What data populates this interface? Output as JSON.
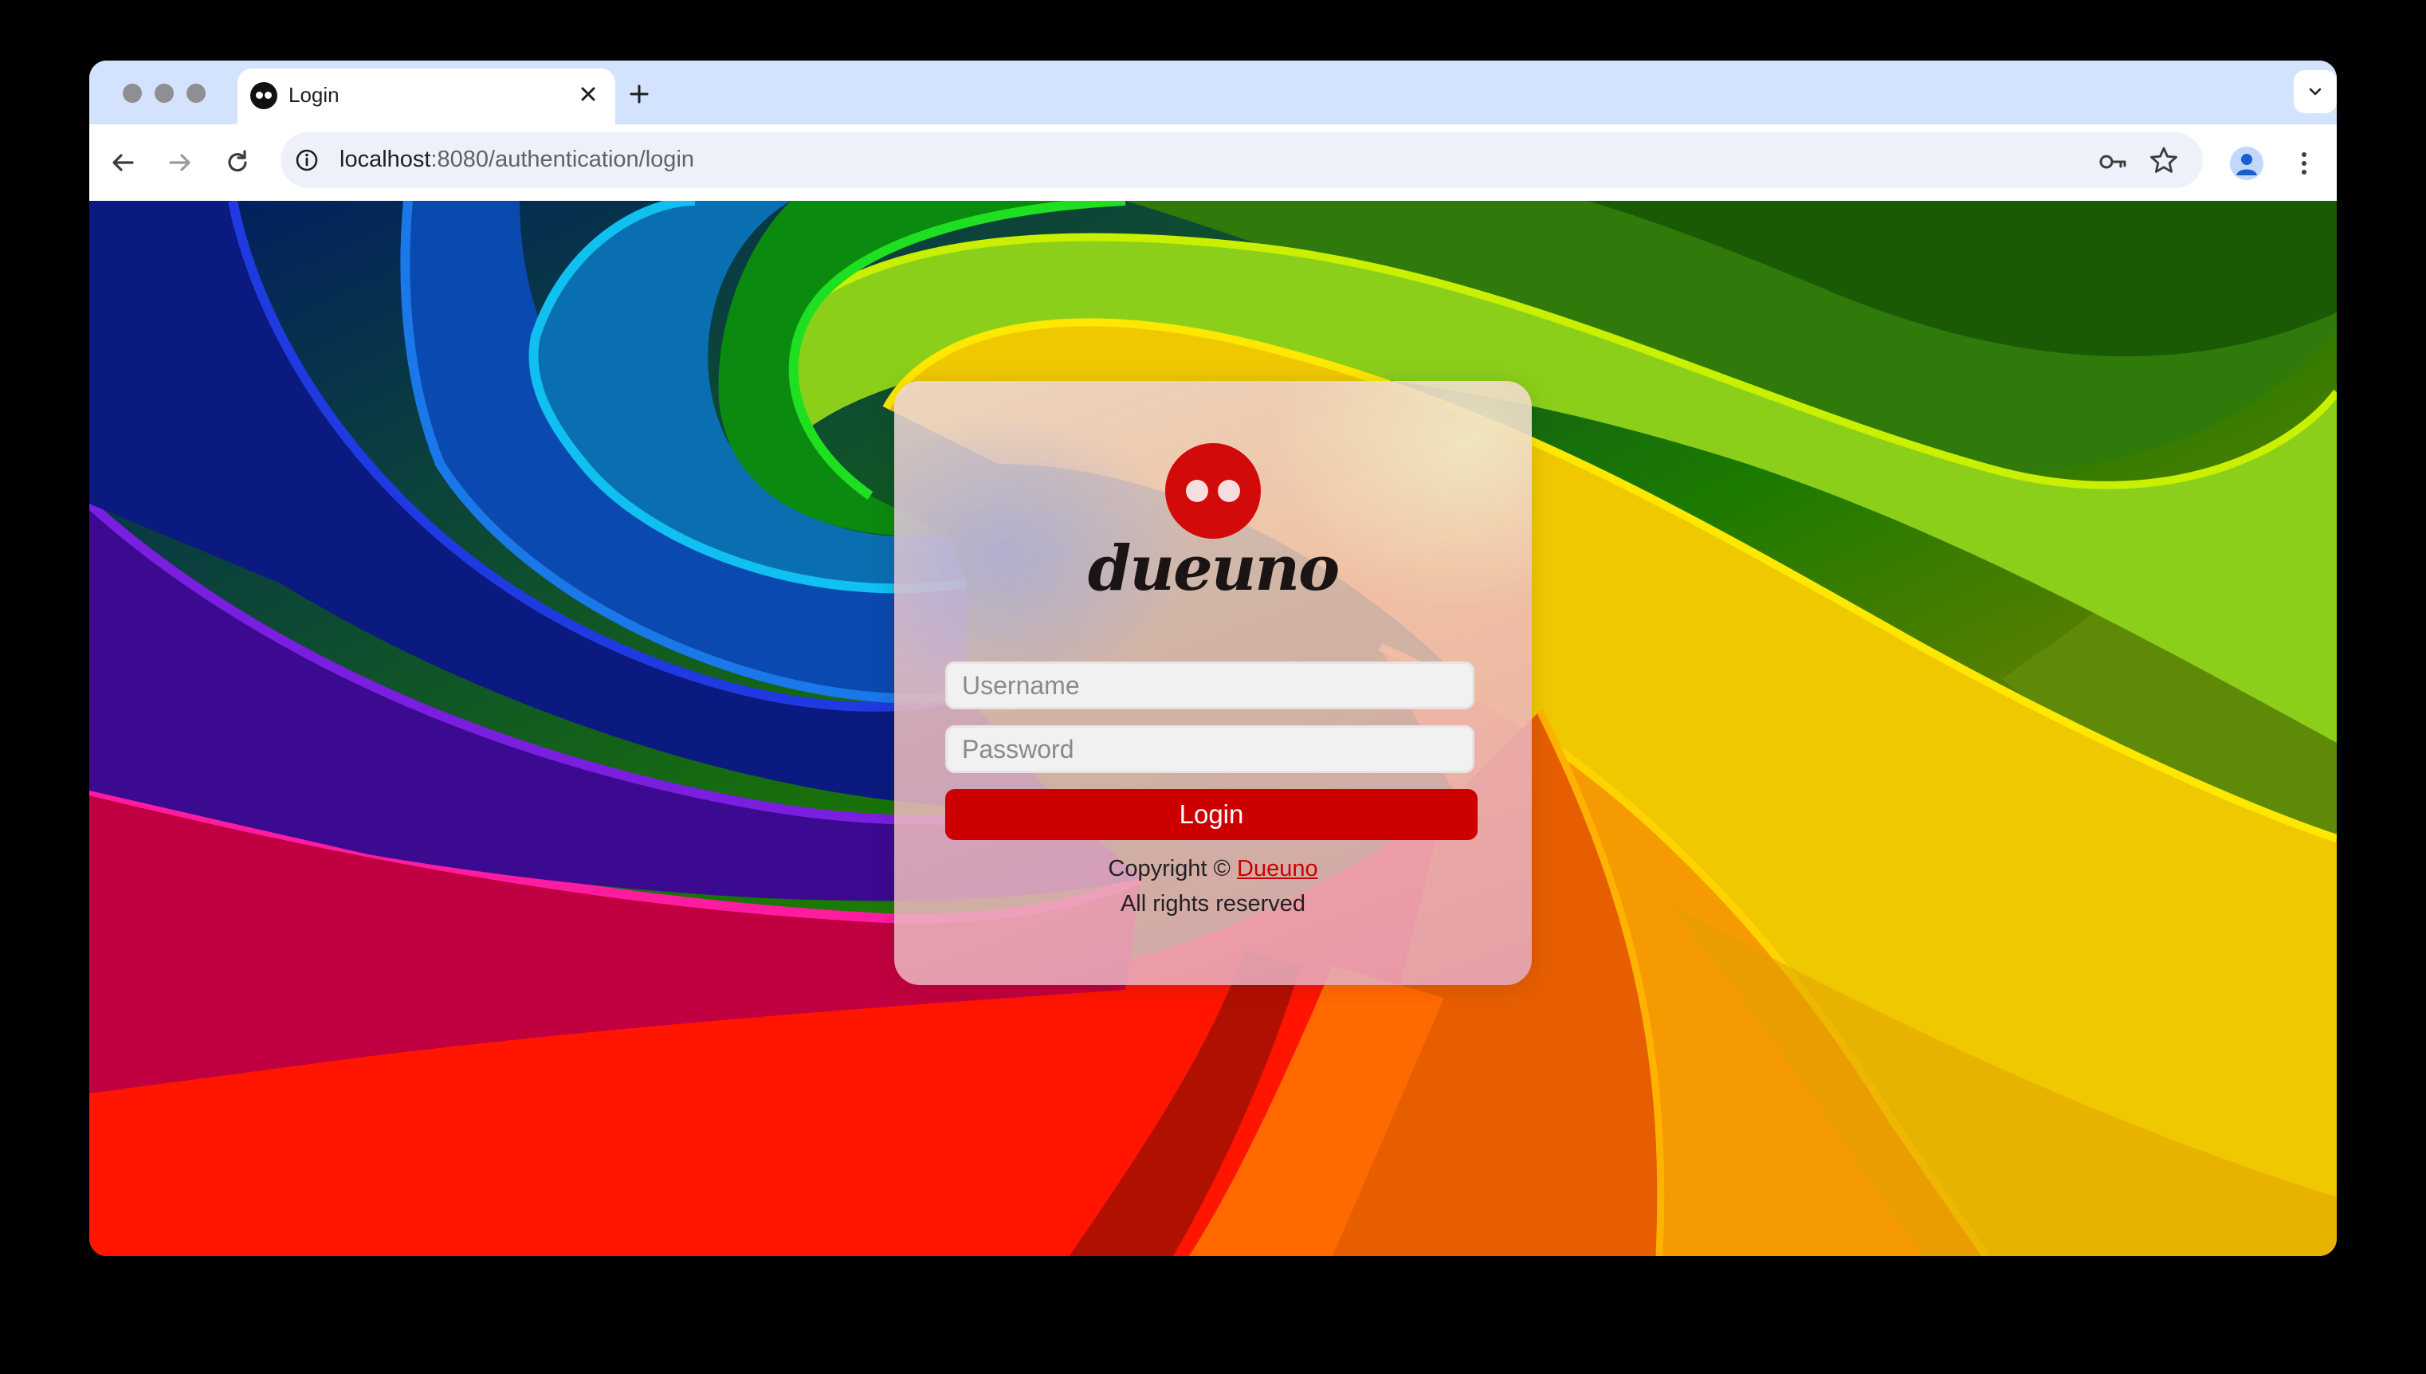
{
  "browser": {
    "tab": {
      "title": "Login",
      "favicon": "dueuno-logo-icon"
    },
    "address_bar": {
      "url_host": "localhost",
      "url_rest": ":8080/authentication/login"
    },
    "icons": [
      "back-arrow-icon",
      "forward-arrow-icon",
      "reload-icon",
      "site-info-icon",
      "password-key-icon",
      "bookmark-star-icon",
      "profile-icon",
      "more-menu-icon",
      "new-tab-plus-icon",
      "close-icon",
      "tab-search-chevron-icon"
    ]
  },
  "login": {
    "brand": "dueuno",
    "username_placeholder": "Username",
    "password_placeholder": "Password",
    "username_value": "",
    "password_value": "",
    "button_label": "Login",
    "copyright_prefix": "Copyright ©",
    "copyright_link": "Dueuno",
    "rights": "All rights reserved"
  },
  "colors": {
    "accent": "#cc0000",
    "tabstrip": "#d3e3fd",
    "omnibox": "#eef1fa"
  }
}
